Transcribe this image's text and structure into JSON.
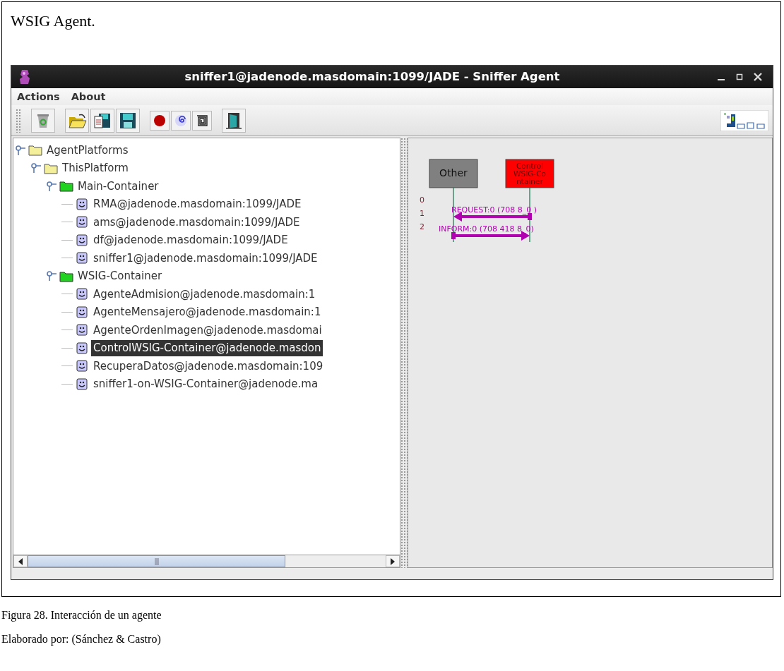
{
  "heading": "WSIG Agent.",
  "window": {
    "title": "sniffer1@jadenode.masdomain:1099/JADE - Sniffer Agent",
    "menu": [
      "Actions",
      "About"
    ],
    "tree": [
      {
        "label": "AgentPlatforms",
        "kind": "folder",
        "expanded": true,
        "selected": false,
        "children": [
          {
            "label": "ThisPlatform",
            "kind": "folder",
            "expanded": true,
            "selected": false,
            "children": [
              {
                "label": "Main-Container",
                "kind": "container",
                "expanded": true,
                "selected": false,
                "children": [
                  {
                    "label": "RMA@jadenode.masdomain:1099/JADE",
                    "kind": "agent",
                    "selected": false
                  },
                  {
                    "label": "ams@jadenode.masdomain:1099/JADE",
                    "kind": "agent",
                    "selected": false
                  },
                  {
                    "label": "df@jadenode.masdomain:1099/JADE",
                    "kind": "agent",
                    "selected": false
                  },
                  {
                    "label": "sniffer1@jadenode.masdomain:1099/JADE",
                    "kind": "agent",
                    "selected": false
                  }
                ]
              },
              {
                "label": "WSIG-Container",
                "kind": "container",
                "expanded": true,
                "selected": false,
                "children": [
                  {
                    "label": "AgenteAdmision@jadenode.masdomain:1",
                    "kind": "agent",
                    "selected": false
                  },
                  {
                    "label": "AgenteMensajero@jadenode.masdomain:1",
                    "kind": "agent",
                    "selected": false
                  },
                  {
                    "label": "AgenteOrdenImagen@jadenode.masdomai",
                    "kind": "agent",
                    "selected": false
                  },
                  {
                    "label": "ControlWSIG-Container@jadenode.masdon",
                    "kind": "agent",
                    "selected": true
                  },
                  {
                    "label": "RecuperaDatos@jadenode.masdomain:109",
                    "kind": "agent",
                    "selected": false
                  },
                  {
                    "label": "sniffer1-on-WSIG-Container@jadenode.ma",
                    "kind": "agent",
                    "selected": false
                  }
                ]
              }
            ]
          }
        ]
      }
    ],
    "diagram": {
      "agents": [
        {
          "lines": [
            "Other"
          ],
          "color": "#808080"
        },
        {
          "lines": [
            "Control",
            "WSIG-Co",
            "ntainer"
          ],
          "color": "#ff0000"
        }
      ],
      "row_numbers": [
        "0",
        "1",
        "2"
      ],
      "messages": [
        {
          "label": "REQUEST:0 (708 8_0 )",
          "kind": "leftward"
        },
        {
          "label": "INFORM:0 (708 418 8_0)",
          "kind": "rightward"
        }
      ]
    }
  },
  "captions": [
    "Figura 28. Interacción de un agente",
    "Elaborado por: (Sánchez & Castro)"
  ]
}
